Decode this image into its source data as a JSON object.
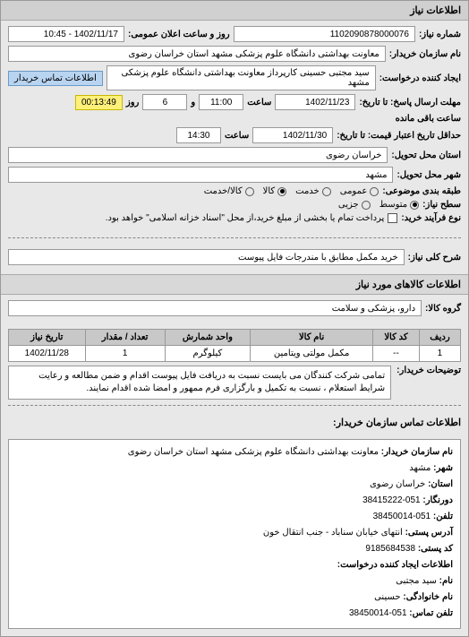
{
  "header": "اطلاعات نیاز",
  "need_number_label": "شماره نیاز:",
  "need_number": "1102090878000076",
  "announce_label": "روز و ساعت اعلان عمومی:",
  "announce_value": "1402/11/17 - 10:45",
  "buyer_label": "نام سازمان خریدار:",
  "buyer_value": "معاونت بهداشتی دانشگاه علوم پزشکی مشهد استان خراسان رضوی",
  "requester_label": "ایجاد کننده درخواست:",
  "requester_value": "سید مجتبی حسینی کارپرداز معاونت بهداشتی دانشگاه علوم پزشکی مشهد",
  "contact_btn": "اطلاعات تماس خریدار",
  "deadline_reply_label": "مهلت ارسال پاسخ: تا تاریخ:",
  "deadline_reply_date": "1402/11/23",
  "time_label": "ساعت",
  "deadline_reply_time": "11:00",
  "days_label": "و",
  "days_value": "6",
  "days_suffix": "روز",
  "remaining_time": "00:13:49",
  "remaining_label": "ساعت باقی مانده",
  "valid_until_label": "حداقل تاریخ اعتبار قیمت: تا تاریخ:",
  "valid_until_date": "1402/11/30",
  "valid_until_time": "14:30",
  "province_label": "استان محل تحویل:",
  "province_value": "خراسان رضوی",
  "city_label": "شهر محل تحویل:",
  "city_value": "مشهد",
  "subject_class_label": "طبقه بندی موضوعی:",
  "radios": {
    "general": "عمومی",
    "service": "خدمت",
    "goods": "کالا",
    "goods_service": "کالا/خدمت"
  },
  "need_level_label": "سطح نیاز:",
  "need_level_mid": "متوسط",
  "need_level_partial": "جزیی",
  "process_label": "نوع فرآیند خرید:",
  "process_checkbox_text": "پرداخت تمام یا بخشی از مبلغ خرید،از محل \"اسناد خزانه اسلامی\" خواهد بود.",
  "general_desc_label": "شرح کلی نیاز:",
  "general_desc_value": "خرید مکمل مطابق با مندرجات فایل پیوست",
  "items_header": "اطلاعات کالاهای مورد نیاز",
  "group_label": "گروه کالا:",
  "group_value": "دارو، پزشکی و سلامت",
  "table": {
    "headers": [
      "ردیف",
      "کد کالا",
      "نام کالا",
      "واحد شمارش",
      "تعداد / مقدار",
      "تاریخ نیاز"
    ],
    "rows": [
      [
        "1",
        "--",
        "مکمل مولتی ویتامین",
        "کیلوگرم",
        "1",
        "1402/11/28"
      ]
    ]
  },
  "notes_label": "توضیحات خریدار:",
  "notes_text": "تمامی شرکت کنندگان می بایست نسبت به دریافت فایل پیوست اقدام و ضمن مطالعه و رعایت شرایط استعلام ، نسبت به تکمیل و بارگزاری فرم ممهور و امضا شده اقدام نمایند.",
  "contact_header": "اطلاعات تماس سازمان خریدار:",
  "contact": {
    "org_label": "نام سازمان خریدار:",
    "org_value": "معاونت بهداشتی دانشگاه علوم پزشکی مشهد استان خراسان رضوی",
    "city_label": "شهر:",
    "city_value": "مشهد",
    "province_label": "استان:",
    "province_value": "خراسان رضوی",
    "tel_label": "تلفن:",
    "tel_value": "051-38450014",
    "fax_label": "دورنگار:",
    "fax_value": "051-38415222",
    "address_label": "آدرس پستی:",
    "address_value": "انتهای خیابان سناباد - جنب انتقال خون",
    "postal_label": "کد پستی:",
    "postal_value": "9185684538",
    "creator_header": "اطلاعات ایجاد کننده درخواست:",
    "name_label": "نام:",
    "name_value": "سید مجتبی",
    "family_label": "نام خانوادگی:",
    "family_value": "حسینی",
    "ctel_label": "تلفن تماس:",
    "ctel_value": "051-38450014"
  }
}
